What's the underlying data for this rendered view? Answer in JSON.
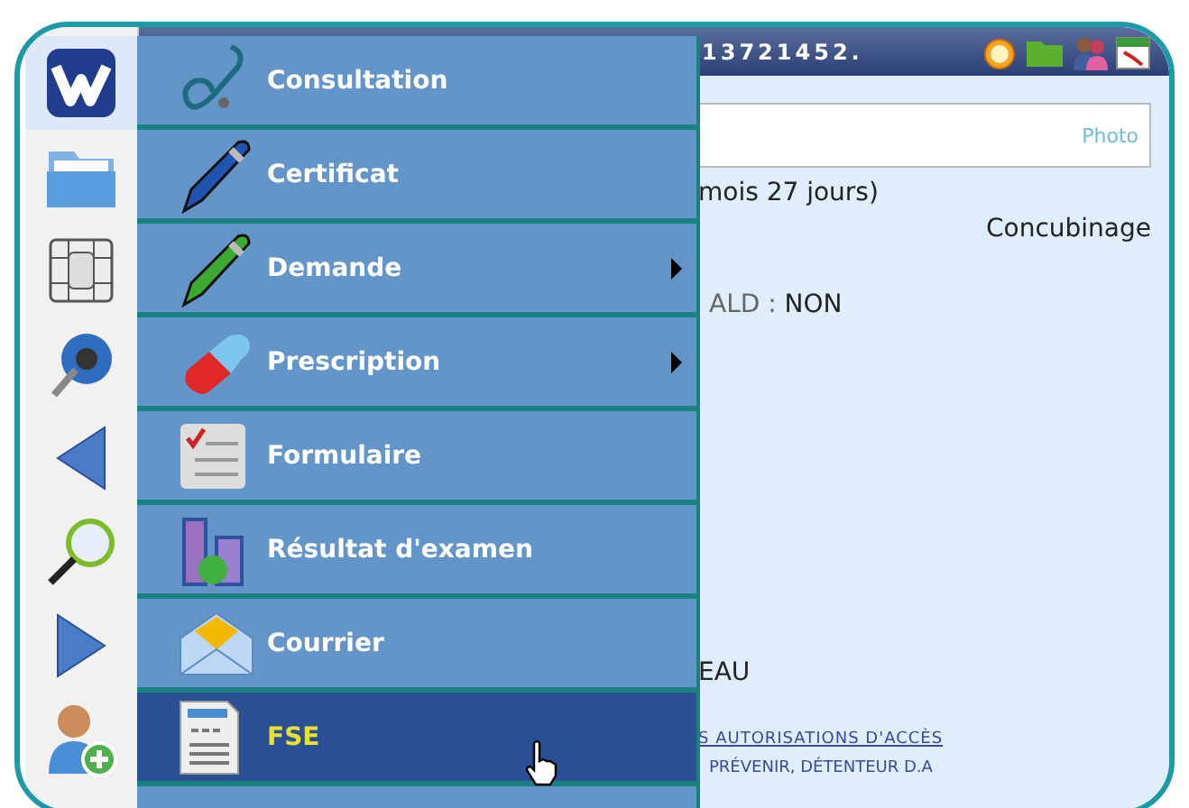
{
  "header": {
    "patient_id": "13721452."
  },
  "photo": {
    "label": "Photo"
  },
  "details": {
    "age": "mois 27 jours)",
    "family_status": "Concubinage",
    "ald_label": "ALD :",
    "ald_value": "NON",
    "name_fragment": "EAU",
    "access_link": "S AUTORISATIONS D'ACCÈS",
    "notice": "PRÉVENIR, DÉTENTEUR D.A"
  },
  "sidebar": {
    "items": [
      {
        "kind": "logo",
        "selected": true
      },
      {
        "kind": "folder",
        "selected": false
      },
      {
        "kind": "chip",
        "selected": false
      },
      {
        "kind": "globe",
        "selected": false
      },
      {
        "kind": "back",
        "selected": false
      },
      {
        "kind": "search",
        "selected": false
      },
      {
        "kind": "forward",
        "selected": false
      },
      {
        "kind": "add-user",
        "selected": false
      }
    ]
  },
  "menu": {
    "items": [
      {
        "label": "Consultation",
        "kind": "stethoscope",
        "submenu": false,
        "selected": false
      },
      {
        "label": "Certificat",
        "kind": "blue-pen",
        "submenu": false,
        "selected": false
      },
      {
        "label": "Demande",
        "kind": "green-pen",
        "submenu": true,
        "selected": false
      },
      {
        "label": "Prescription",
        "kind": "capsule",
        "submenu": true,
        "selected": false
      },
      {
        "label": "Formulaire",
        "kind": "form",
        "submenu": false,
        "selected": false
      },
      {
        "label": "Résultat d'examen",
        "kind": "lab",
        "submenu": false,
        "selected": false
      },
      {
        "label": "Courrier",
        "kind": "envelope",
        "submenu": false,
        "selected": false
      },
      {
        "label": "FSE",
        "kind": "document",
        "submenu": false,
        "selected": true
      }
    ]
  }
}
